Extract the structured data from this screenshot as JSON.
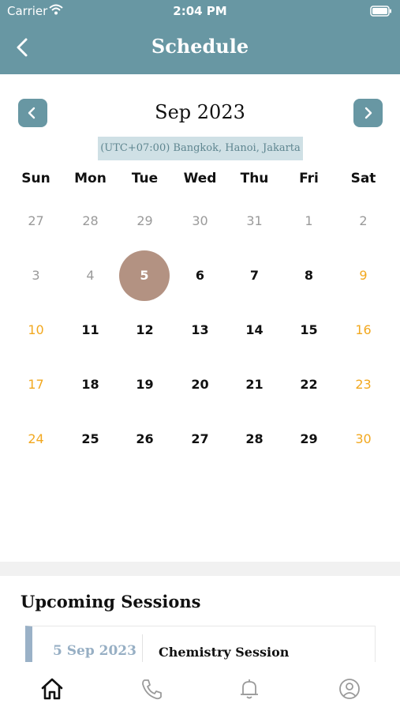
{
  "status_bar": {
    "carrier": "Carrier",
    "time": "2:04 PM"
  },
  "header": {
    "title": "Schedule"
  },
  "calendar": {
    "month_label": "Sep 2023",
    "timezone": "(UTC+07:00) Bangkok, Hanoi, Jakarta",
    "weekdays": [
      "Sun",
      "Mon",
      "Tue",
      "Wed",
      "Thu",
      "Fri",
      "Sat"
    ],
    "weeks": [
      [
        "27",
        "28",
        "29",
        "30",
        "31",
        "1",
        "2"
      ],
      [
        "3",
        "4",
        "5",
        "6",
        "7",
        "8",
        "9"
      ],
      [
        "10",
        "11",
        "12",
        "13",
        "14",
        "15",
        "16"
      ],
      [
        "17",
        "18",
        "19",
        "20",
        "21",
        "22",
        "23"
      ],
      [
        "24",
        "25",
        "26",
        "27",
        "28",
        "29",
        "30"
      ]
    ],
    "selected_day": "5",
    "colors": {
      "accent": "#6897a3",
      "selected": "#b39282",
      "weekend": "#f2a81f",
      "muted": "#9a9a9a"
    }
  },
  "upcoming": {
    "title": "Upcoming Sessions",
    "sessions": [
      {
        "date": "5 Sep 2023",
        "name": "Chemistry Session"
      }
    ]
  },
  "tabbar": {
    "items": [
      {
        "icon": "home-icon",
        "active": true
      },
      {
        "icon": "phone-icon",
        "active": false
      },
      {
        "icon": "bell-icon",
        "active": false
      },
      {
        "icon": "profile-icon",
        "active": false
      }
    ]
  }
}
